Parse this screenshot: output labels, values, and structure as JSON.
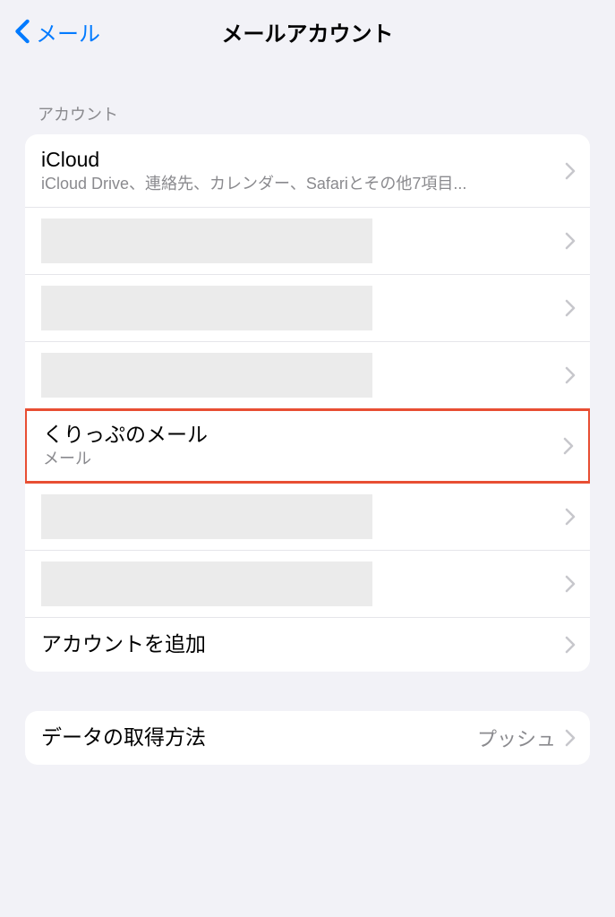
{
  "nav": {
    "back_label": "メール",
    "title": "メールアカウント"
  },
  "accounts_section": {
    "header": "アカウント",
    "items": [
      {
        "title": "iCloud",
        "subtitle": "iCloud Drive、連絡先、カレンダー、Safariとその他7項目...",
        "highlighted": false,
        "redacted": false
      },
      {
        "redacted": true
      },
      {
        "redacted": true
      },
      {
        "redacted": true
      },
      {
        "title": "くりっぷのメール",
        "subtitle": "メール",
        "highlighted": true,
        "redacted": false
      },
      {
        "redacted": true
      },
      {
        "redacted": true
      }
    ],
    "add_account_label": "アカウントを追加"
  },
  "fetch_section": {
    "label": "データの取得方法",
    "value": "プッシュ"
  }
}
